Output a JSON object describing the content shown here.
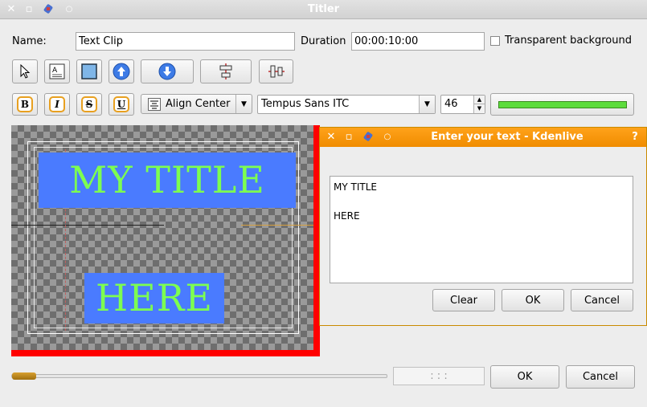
{
  "window": {
    "title": "Titler"
  },
  "form": {
    "name_label": "Name:",
    "name_value": "Text Clip",
    "duration_label": "Duration",
    "duration_value": "00:00:10:00",
    "transparent_label": "Transparent background",
    "transparent_checked": false
  },
  "format": {
    "align_label": "Align Center",
    "font_value": "Tempus Sans ITC",
    "size_value": "46",
    "color_swatch": "#5cdc3c"
  },
  "canvas": {
    "title_text": "MY TITLE",
    "here_text": "HERE",
    "text_color": "#7dff50",
    "box_color": "#4a7bff",
    "border_color": "#ff0000"
  },
  "dialog": {
    "title": "Enter your text - Kdenlive",
    "help": "?",
    "text_value": "MY TITLE\n\nHERE",
    "clear_label": "Clear",
    "ok_label": "OK",
    "cancel_label": "Cancel"
  },
  "bottom": {
    "timecode": ": : :",
    "ok_label": "OK",
    "cancel_label": "Cancel",
    "slider_position": 0
  }
}
